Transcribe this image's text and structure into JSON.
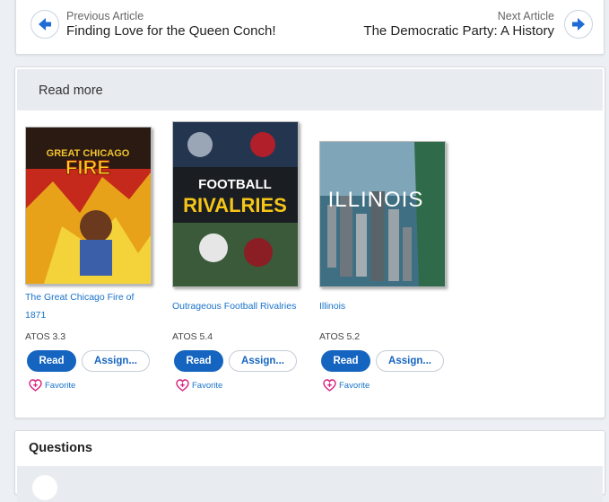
{
  "nav": {
    "prev_kicker": "Previous Article",
    "prev_title": "Finding Love for the Queen Conch!",
    "next_kicker": "Next Article",
    "next_title": "The Democratic Party: A History"
  },
  "read_more": {
    "heading": "Read more",
    "read_label": "Read",
    "assign_label": "Assign...",
    "favorite_label": "Favorite",
    "atos_label": "ATOS",
    "books": [
      {
        "title": "The Great Chicago Fire of 1871",
        "atos": "3.3",
        "cover_text": "The Great Chicago Fire"
      },
      {
        "title": "Outrageous Football Rivalries",
        "atos": "5.4",
        "cover_text": "Football Rivalries"
      },
      {
        "title": "Illinois",
        "atos": "5.2",
        "cover_text": "Illinois"
      }
    ]
  },
  "questions": {
    "heading": "Questions"
  },
  "colors": {
    "accent": "#1565c0",
    "link": "#1a73c9",
    "favorite": "#d81b7a"
  }
}
